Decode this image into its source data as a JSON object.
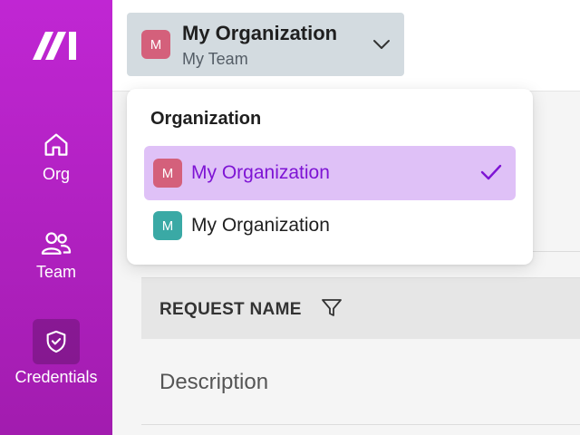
{
  "colors": {
    "sidebar": "#b623d0",
    "accent": "#7e14d4",
    "selected_bg": "#dfc1f7",
    "avatar_red": "#d4607b",
    "avatar_teal": "#3aa9a5"
  },
  "sidebar": {
    "logo_icon": "make-logo",
    "items": [
      {
        "label": "Org",
        "icon": "home-icon"
      },
      {
        "label": "Team",
        "icon": "users-icon"
      },
      {
        "label": "Credentials",
        "icon": "shield-check-icon",
        "active": true
      }
    ]
  },
  "org_switcher": {
    "avatar_letter": "M",
    "org_name": "My Organization",
    "team_name": "My Team",
    "icon": "chevron-down-icon"
  },
  "dropdown": {
    "heading": "Organization",
    "options": [
      {
        "avatar_letter": "M",
        "label": "My Organization",
        "selected": true
      },
      {
        "avatar_letter": "M",
        "label": "My Organization",
        "selected": false
      }
    ]
  },
  "table": {
    "columns": [
      {
        "label": "REQUEST NAME",
        "icon": "filter-icon"
      }
    ],
    "rows": [
      {
        "text": "Description"
      }
    ]
  }
}
